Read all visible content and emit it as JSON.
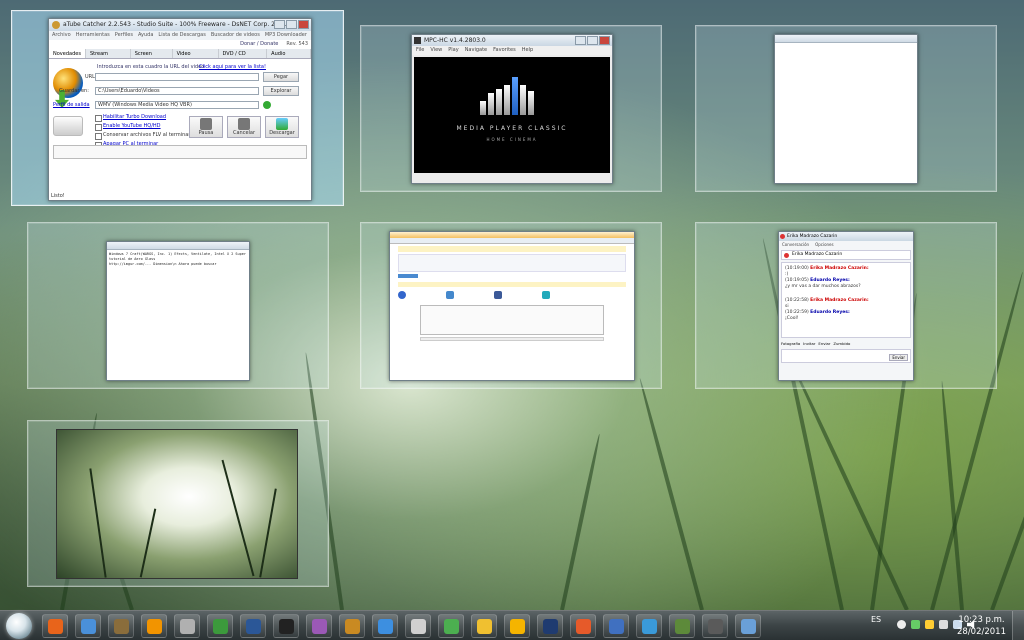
{
  "atube": {
    "title": "aTube Catcher 2.2.543 - Studio Suite - 100% Freeware - DsNET Corp. 2011",
    "menu": [
      "Archivo",
      "Herramientas",
      "Perfiles",
      "Ayuda",
      "Lista de Descargas",
      "Buscador de videos",
      "MP3 Downloader"
    ],
    "menu_right": "Donar / Donate",
    "menu_right2": "Rev. 543",
    "tabs": [
      "Novedades",
      "Stream Catcher",
      "Screen Record",
      "Video Converter",
      "DVD / CD Creator",
      "Audio Recorder"
    ],
    "url_hint": "Introduzca en esta cuadro la URL del video",
    "url_link": "Click aqui para ver la lista!",
    "url_label": "URL:",
    "paste_btn": "Pegar",
    "save_label": "Guardar en:",
    "save_path": "C:\\Users\\Eduardo\\Videos",
    "browse_btn": "Explorar",
    "profile_label": "Perfil de salida",
    "profile_value": "WMV (Windows Media Video HQ VBR)",
    "opt1": "Habilitar Turbo Download",
    "opt2": "Enable YouTube HQ/HD",
    "opt3": "Conservar archivos FLV al terminar",
    "opt4": "Apagar PC al terminar",
    "btn_pause": "Pausa",
    "btn_cancel": "Cancelar",
    "btn_download": "Descargar",
    "status": "Listo!"
  },
  "mpc": {
    "title": "MPC-HC v1.4.2803.0",
    "menu": [
      "File",
      "View",
      "Play",
      "Navigate",
      "Favorites",
      "Help"
    ],
    "logo_text": "MEDIA PLAYER CLASSIC",
    "logo_sub": "HOME CINEMA"
  },
  "notepad": {
    "text": "Windows 7 Craft(WARGS, Inc. 1) Efects, Ventilate, Intel X 2 Super tutorial de Aero Glass\nhttp://imgur.com/... Dimension\\n Ahora puede buscar"
  },
  "messenger": {
    "title": "Erika Madrazo Cazarin",
    "menu": [
      "Conversación",
      "Opciones"
    ],
    "header_name": "Erika Madrazo Cazarin",
    "lines": [
      {
        "time": "(10:19:00)",
        "name": "Erika Madrazo Cazarin:",
        "text": ":)"
      },
      {
        "time": "(10:19:05)",
        "name": "Eduardo Reyes:",
        "text": "¿y mr vas a dar muchos abrazos?"
      },
      {
        "time": "(10:22:58)",
        "name": "Erika Madrazo Cazarin:",
        "text": "si"
      },
      {
        "time": "(10:22:59)",
        "name": "Eduardo Reyes:",
        "text": "¡Cool!"
      }
    ],
    "tools": [
      "Fotografía",
      "Invitar",
      "Enviar",
      "Zumbido"
    ],
    "send": "Enviar"
  },
  "tray": {
    "language": "ES",
    "time": "10:23 p.m.",
    "date": "28/02/2011"
  },
  "taskbar": {
    "icons": [
      {
        "name": "firefox-icon",
        "color": "#e8641b"
      },
      {
        "name": "chrome-icon",
        "color": "#4a90d9"
      },
      {
        "name": "games-icon",
        "color": "#8a6d3b"
      },
      {
        "name": "vlc-icon",
        "color": "#f29400"
      },
      {
        "name": "media-center-icon",
        "color": "#b0b0b0"
      },
      {
        "name": "utorrent-icon",
        "color": "#3c9a3c"
      },
      {
        "name": "word-icon",
        "color": "#2b5797"
      },
      {
        "name": "mpc-icon",
        "color": "#222222"
      },
      {
        "name": "app-icon",
        "color": "#9b59b6"
      },
      {
        "name": "atube-icon",
        "color": "#c98a22"
      },
      {
        "name": "dropbox-icon",
        "color": "#3d8fe0"
      },
      {
        "name": "recycle-icon",
        "color": "#d0d0d0"
      },
      {
        "name": "owl-icon",
        "color": "#4caf50"
      },
      {
        "name": "explorer-icon",
        "color": "#f0c030"
      },
      {
        "name": "star-icon",
        "color": "#f5b400"
      },
      {
        "name": "photoshop-icon",
        "color": "#1f3b70"
      },
      {
        "name": "burn-icon",
        "color": "#e65a2a"
      },
      {
        "name": "globe-icon",
        "color": "#4070c0"
      },
      {
        "name": "weather-icon",
        "color": "#3a9ad9"
      },
      {
        "name": "minecraft-icon",
        "color": "#5d8a3a"
      },
      {
        "name": "tools-icon",
        "color": "#5a5a5a"
      },
      {
        "name": "settings-icon",
        "color": "#6aa0d8"
      }
    ]
  }
}
